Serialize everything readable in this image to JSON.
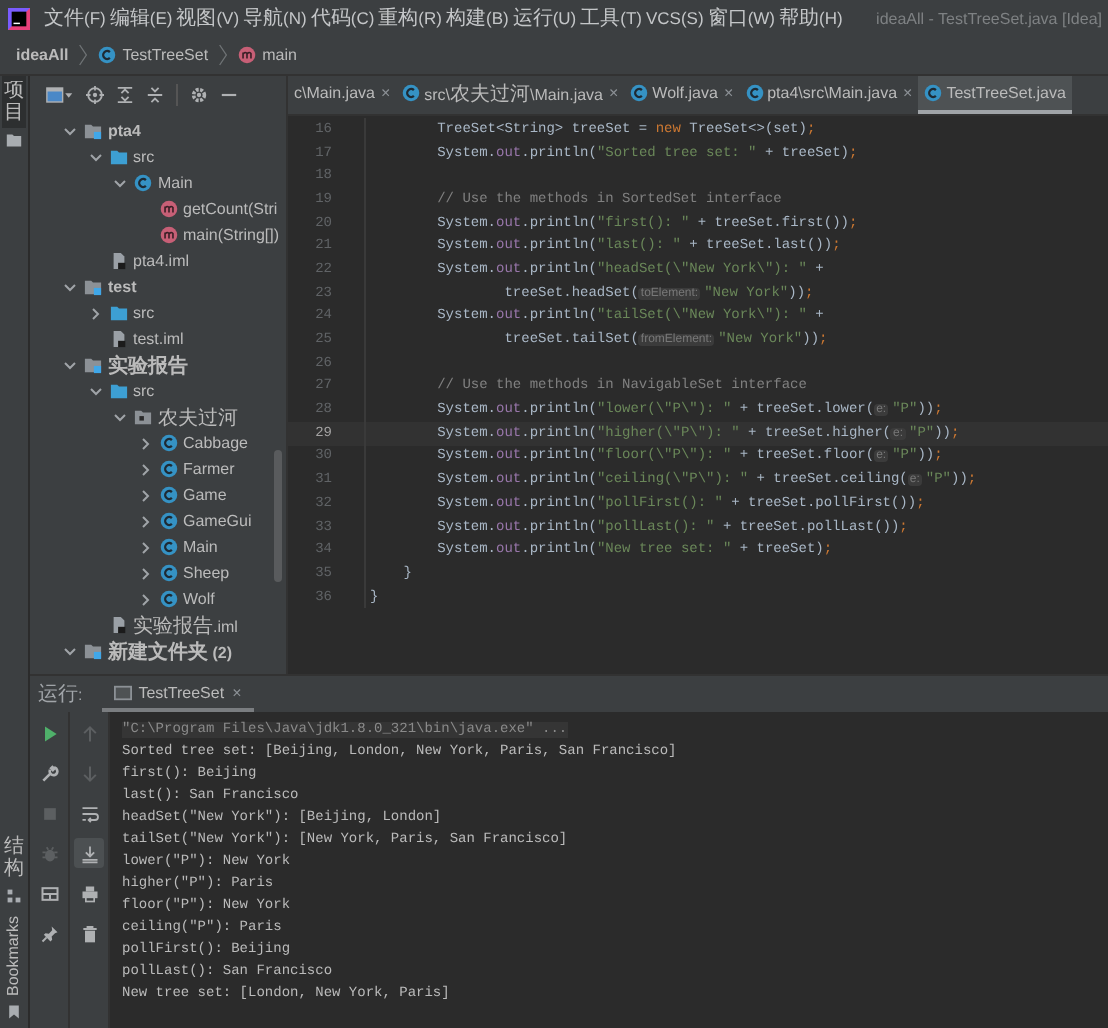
{
  "menu": [
    "文件(F)",
    "编辑(E)",
    "视图(V)",
    "导航(N)",
    "代码(C)",
    "重构(R)",
    "构建(B)",
    "运行(U)",
    "工具(T)",
    "VCS(S)",
    "窗口(W)",
    "帮助(H)"
  ],
  "window": {
    "title": "ideaAll - TestTreeSet.java [Idea]"
  },
  "breadcrumb": [
    {
      "label": "ideaAll",
      "kind": "project"
    },
    {
      "label": "TestTreeSet",
      "kind": "class"
    },
    {
      "label": "main",
      "kind": "method"
    }
  ],
  "tool_strip": {
    "top": "项目",
    "bottom": [
      {
        "label": "结构",
        "kind": "structure"
      },
      {
        "label": "Bookmarks",
        "kind": "bookmarks"
      }
    ]
  },
  "project_tree": [
    {
      "label": "pta4",
      "kind": "module",
      "expanded": true,
      "children": [
        {
          "label": "src",
          "kind": "folder",
          "expanded": true,
          "children": [
            {
              "label": "Main",
              "kind": "class",
              "expanded": true,
              "children": [
                {
                  "label": "getCount(Stri",
                  "kind": "method"
                },
                {
                  "label": "main(String[])",
                  "kind": "method"
                }
              ]
            }
          ]
        },
        {
          "label": "pta4.iml",
          "kind": "file"
        }
      ]
    },
    {
      "label": "test",
      "kind": "module",
      "expanded": true,
      "children": [
        {
          "label": "src",
          "kind": "folder",
          "expanded": false
        },
        {
          "label": "test.iml",
          "kind": "file"
        }
      ]
    },
    {
      "label": "实验报告",
      "kind": "module",
      "expanded": true,
      "children": [
        {
          "label": "src",
          "kind": "folder",
          "expanded": true,
          "children": [
            {
              "label": "农夫过河",
              "kind": "package",
              "expanded": true,
              "children": [
                {
                  "label": "Cabbage",
                  "kind": "class",
                  "expanded": false
                },
                {
                  "label": "Farmer",
                  "kind": "class",
                  "expanded": false
                },
                {
                  "label": "Game",
                  "kind": "class",
                  "expanded": false
                },
                {
                  "label": "GameGui",
                  "kind": "class",
                  "expanded": false
                },
                {
                  "label": "Main",
                  "kind": "class",
                  "expanded": false
                },
                {
                  "label": "Sheep",
                  "kind": "class",
                  "expanded": false
                },
                {
                  "label": "Wolf",
                  "kind": "class",
                  "expanded": false
                }
              ]
            }
          ]
        },
        {
          "label": "实验报告.iml",
          "kind": "file"
        }
      ]
    },
    {
      "label": "新建文件夹 (2)",
      "kind": "module",
      "expanded": true
    }
  ],
  "tabs": [
    {
      "label": "c\\Main.java",
      "kind": "cut",
      "close": "×",
      "selected": false
    },
    {
      "label": "src\\农夫过河\\Main.java",
      "kind": "class",
      "close": "×",
      "selected": false
    },
    {
      "label": "Wolf.java",
      "kind": "class",
      "close": "×",
      "selected": false
    },
    {
      "label": "pta4\\src\\Main.java",
      "kind": "class",
      "close": "×",
      "selected": false
    },
    {
      "label": "TestTreeSet.java",
      "kind": "class",
      "selected": true
    }
  ],
  "code_lines": [
    {
      "number": "16",
      "current": false,
      "tokens": [
        {
          "kind": "plain",
          "text": "        TreeSet<String> treeSet = "
        },
        {
          "kind": "keyword",
          "text": "new"
        },
        {
          "kind": "plain",
          "text": " TreeSet<>(set)"
        },
        {
          "kind": "punct",
          "text": ";"
        }
      ]
    },
    {
      "number": "17",
      "current": false,
      "tokens": [
        {
          "kind": "plain",
          "text": "        System."
        },
        {
          "kind": "field",
          "text": "out"
        },
        {
          "kind": "plain",
          "text": ".println("
        },
        {
          "kind": "string",
          "text": "\"Sorted tree set: \""
        },
        {
          "kind": "plain",
          "text": " + treeSet)"
        },
        {
          "kind": "punct",
          "text": ";"
        }
      ]
    },
    {
      "number": "18",
      "current": false
    },
    {
      "number": "19",
      "current": false,
      "tokens": [
        {
          "kind": "comment",
          "text": "        // Use the methods in SortedSet interface"
        }
      ]
    },
    {
      "number": "20",
      "current": false,
      "tokens": [
        {
          "kind": "plain",
          "text": "        System."
        },
        {
          "kind": "field",
          "text": "out"
        },
        {
          "kind": "plain",
          "text": ".println("
        },
        {
          "kind": "string",
          "text": "\"first(): \""
        },
        {
          "kind": "plain",
          "text": " + treeSet.first())"
        },
        {
          "kind": "punct",
          "text": ";"
        }
      ]
    },
    {
      "number": "21",
      "current": false,
      "tokens": [
        {
          "kind": "plain",
          "text": "        System."
        },
        {
          "kind": "field",
          "text": "out"
        },
        {
          "kind": "plain",
          "text": ".println("
        },
        {
          "kind": "string",
          "text": "\"last(): \""
        },
        {
          "kind": "plain",
          "text": " + treeSet.last())"
        },
        {
          "kind": "punct",
          "text": ";"
        }
      ]
    },
    {
      "number": "22",
      "current": false,
      "tokens": [
        {
          "kind": "plain",
          "text": "        System."
        },
        {
          "kind": "field",
          "text": "out"
        },
        {
          "kind": "plain",
          "text": ".println("
        },
        {
          "kind": "string",
          "text": "\"headSet(\\\"New York\\\"): \""
        },
        {
          "kind": "plain",
          "text": " +"
        }
      ]
    },
    {
      "number": "23",
      "current": false,
      "tokens": [
        {
          "kind": "plain",
          "text": "                treeSet.headSet("
        },
        {
          "kind": "hint",
          "text": "toElement:"
        },
        {
          "kind": "string",
          "text": "\"New York\""
        },
        {
          "kind": "plain",
          "text": "))"
        },
        {
          "kind": "punct",
          "text": ";"
        }
      ]
    },
    {
      "number": "24",
      "current": false,
      "tokens": [
        {
          "kind": "plain",
          "text": "        System."
        },
        {
          "kind": "field",
          "text": "out"
        },
        {
          "kind": "plain",
          "text": ".println("
        },
        {
          "kind": "string",
          "text": "\"tailSet(\\\"New York\\\"): \""
        },
        {
          "kind": "plain",
          "text": " +"
        }
      ]
    },
    {
      "number": "25",
      "current": false,
      "tokens": [
        {
          "kind": "plain",
          "text": "                treeSet.tailSet("
        },
        {
          "kind": "hint",
          "text": "fromElement:"
        },
        {
          "kind": "string",
          "text": "\"New York\""
        },
        {
          "kind": "plain",
          "text": "))"
        },
        {
          "kind": "punct",
          "text": ";"
        }
      ]
    },
    {
      "number": "26",
      "current": false
    },
    {
      "number": "27",
      "current": false,
      "tokens": [
        {
          "kind": "comment",
          "text": "        // Use the methods in NavigableSet interface"
        }
      ]
    },
    {
      "number": "28",
      "current": false,
      "tokens": [
        {
          "kind": "plain",
          "text": "        System."
        },
        {
          "kind": "field",
          "text": "out"
        },
        {
          "kind": "plain",
          "text": ".println("
        },
        {
          "kind": "string",
          "text": "\"lower(\\\"P\\\"): \""
        },
        {
          "kind": "plain",
          "text": " + treeSet.lower("
        },
        {
          "kind": "hint",
          "text": "e:"
        },
        {
          "kind": "string",
          "text": "\"P\""
        },
        {
          "kind": "plain",
          "text": "))"
        },
        {
          "kind": "punct",
          "text": ";"
        }
      ]
    },
    {
      "number": "29",
      "current": true,
      "tokens": [
        {
          "kind": "plain",
          "text": "        System."
        },
        {
          "kind": "field",
          "text": "out"
        },
        {
          "kind": "plain",
          "text": ".println("
        },
        {
          "kind": "string",
          "text": "\"higher(\\\"P\\\"): \""
        },
        {
          "kind": "plain",
          "text": " + treeSet.higher("
        },
        {
          "kind": "hint",
          "text": "e:"
        },
        {
          "kind": "string",
          "text": "\"P\""
        },
        {
          "kind": "plain",
          "text": "))"
        },
        {
          "kind": "punct",
          "text": ";"
        }
      ]
    },
    {
      "number": "30",
      "current": false,
      "tokens": [
        {
          "kind": "plain",
          "text": "        System."
        },
        {
          "kind": "field",
          "text": "out"
        },
        {
          "kind": "plain",
          "text": ".println("
        },
        {
          "kind": "string",
          "text": "\"floor(\\\"P\\\"): \""
        },
        {
          "kind": "plain",
          "text": " + treeSet.floor("
        },
        {
          "kind": "hint",
          "text": "e:"
        },
        {
          "kind": "string",
          "text": "\"P\""
        },
        {
          "kind": "plain",
          "text": "))"
        },
        {
          "kind": "punct",
          "text": ";"
        }
      ]
    },
    {
      "number": "31",
      "current": false,
      "tokens": [
        {
          "kind": "plain",
          "text": "        System."
        },
        {
          "kind": "field",
          "text": "out"
        },
        {
          "kind": "plain",
          "text": ".println("
        },
        {
          "kind": "string",
          "text": "\"ceiling(\\\"P\\\"): \""
        },
        {
          "kind": "plain",
          "text": " + treeSet.ceiling("
        },
        {
          "kind": "hint",
          "text": "e:"
        },
        {
          "kind": "string",
          "text": "\"P\""
        },
        {
          "kind": "plain",
          "text": "))"
        },
        {
          "kind": "punct",
          "text": ";"
        }
      ]
    },
    {
      "number": "32",
      "current": false,
      "tokens": [
        {
          "kind": "plain",
          "text": "        System."
        },
        {
          "kind": "field",
          "text": "out"
        },
        {
          "kind": "plain",
          "text": ".println("
        },
        {
          "kind": "string",
          "text": "\"pollFirst(): \""
        },
        {
          "kind": "plain",
          "text": " + treeSet.pollFirst())"
        },
        {
          "kind": "punct",
          "text": ";"
        }
      ]
    },
    {
      "number": "33",
      "current": false,
      "tokens": [
        {
          "kind": "plain",
          "text": "        System."
        },
        {
          "kind": "field",
          "text": "out"
        },
        {
          "kind": "plain",
          "text": ".println("
        },
        {
          "kind": "string",
          "text": "\"pollLast(): \""
        },
        {
          "kind": "plain",
          "text": " + treeSet.pollLast())"
        },
        {
          "kind": "punct",
          "text": ";"
        }
      ]
    },
    {
      "number": "34",
      "current": false,
      "tokens": [
        {
          "kind": "plain",
          "text": "        System."
        },
        {
          "kind": "field",
          "text": "out"
        },
        {
          "kind": "plain",
          "text": ".println("
        },
        {
          "kind": "string",
          "text": "\"New tree set: \""
        },
        {
          "kind": "plain",
          "text": " + treeSet)"
        },
        {
          "kind": "punct",
          "text": ";"
        }
      ]
    },
    {
      "number": "35",
      "current": false,
      "tokens": [
        {
          "kind": "plain",
          "text": "    }"
        }
      ]
    },
    {
      "number": "36",
      "current": false,
      "tokens": [
        {
          "kind": "plain",
          "text": "}"
        }
      ]
    }
  ],
  "run_panel": {
    "label": "运行:",
    "tab": {
      "title": "TestTreeSet",
      "close": "×",
      "selected": true
    },
    "toolbar_left": [
      {
        "kind": "run",
        "disabled": false
      },
      {
        "kind": "wrench",
        "disabled": false
      },
      {
        "kind": "stop",
        "disabled": true
      },
      {
        "kind": "debug",
        "disabled": true
      },
      {
        "kind": "layout",
        "disabled": false
      },
      {
        "kind": "pin",
        "disabled": false
      }
    ],
    "toolbar_right": [
      {
        "kind": "up",
        "disabled": true,
        "selected": false
      },
      {
        "kind": "down",
        "disabled": true,
        "selected": false
      },
      {
        "kind": "wrap",
        "disabled": false,
        "selected": false
      },
      {
        "kind": "scroll-end",
        "disabled": false,
        "selected": true
      },
      {
        "kind": "print",
        "disabled": false,
        "selected": false
      },
      {
        "kind": "trash",
        "disabled": false,
        "selected": false
      }
    ],
    "output": [
      {
        "kind": "command",
        "text": "\"C:\\Program Files\\Java\\jdk1.8.0_321\\bin\\java.exe\" ..."
      },
      {
        "kind": "stdout",
        "text": "Sorted tree set: [Beijing, London, New York, Paris, San Francisco]"
      },
      {
        "kind": "stdout",
        "text": "first(): Beijing"
      },
      {
        "kind": "stdout",
        "text": "last(): San Francisco"
      },
      {
        "kind": "stdout",
        "text": "headSet(\"New York\"): [Beijing, London]"
      },
      {
        "kind": "stdout",
        "text": "tailSet(\"New York\"): [New York, Paris, San Francisco]"
      },
      {
        "kind": "stdout",
        "text": "lower(\"P\"): New York"
      },
      {
        "kind": "stdout",
        "text": "higher(\"P\"): Paris"
      },
      {
        "kind": "stdout",
        "text": "floor(\"P\"): New York"
      },
      {
        "kind": "stdout",
        "text": "ceiling(\"P\"): Paris"
      },
      {
        "kind": "stdout",
        "text": "pollFirst(): Beijing"
      },
      {
        "kind": "stdout",
        "text": "pollLast(): San Francisco"
      },
      {
        "kind": "stdout",
        "text": "New tree set: [London, New York, Paris]"
      }
    ]
  }
}
